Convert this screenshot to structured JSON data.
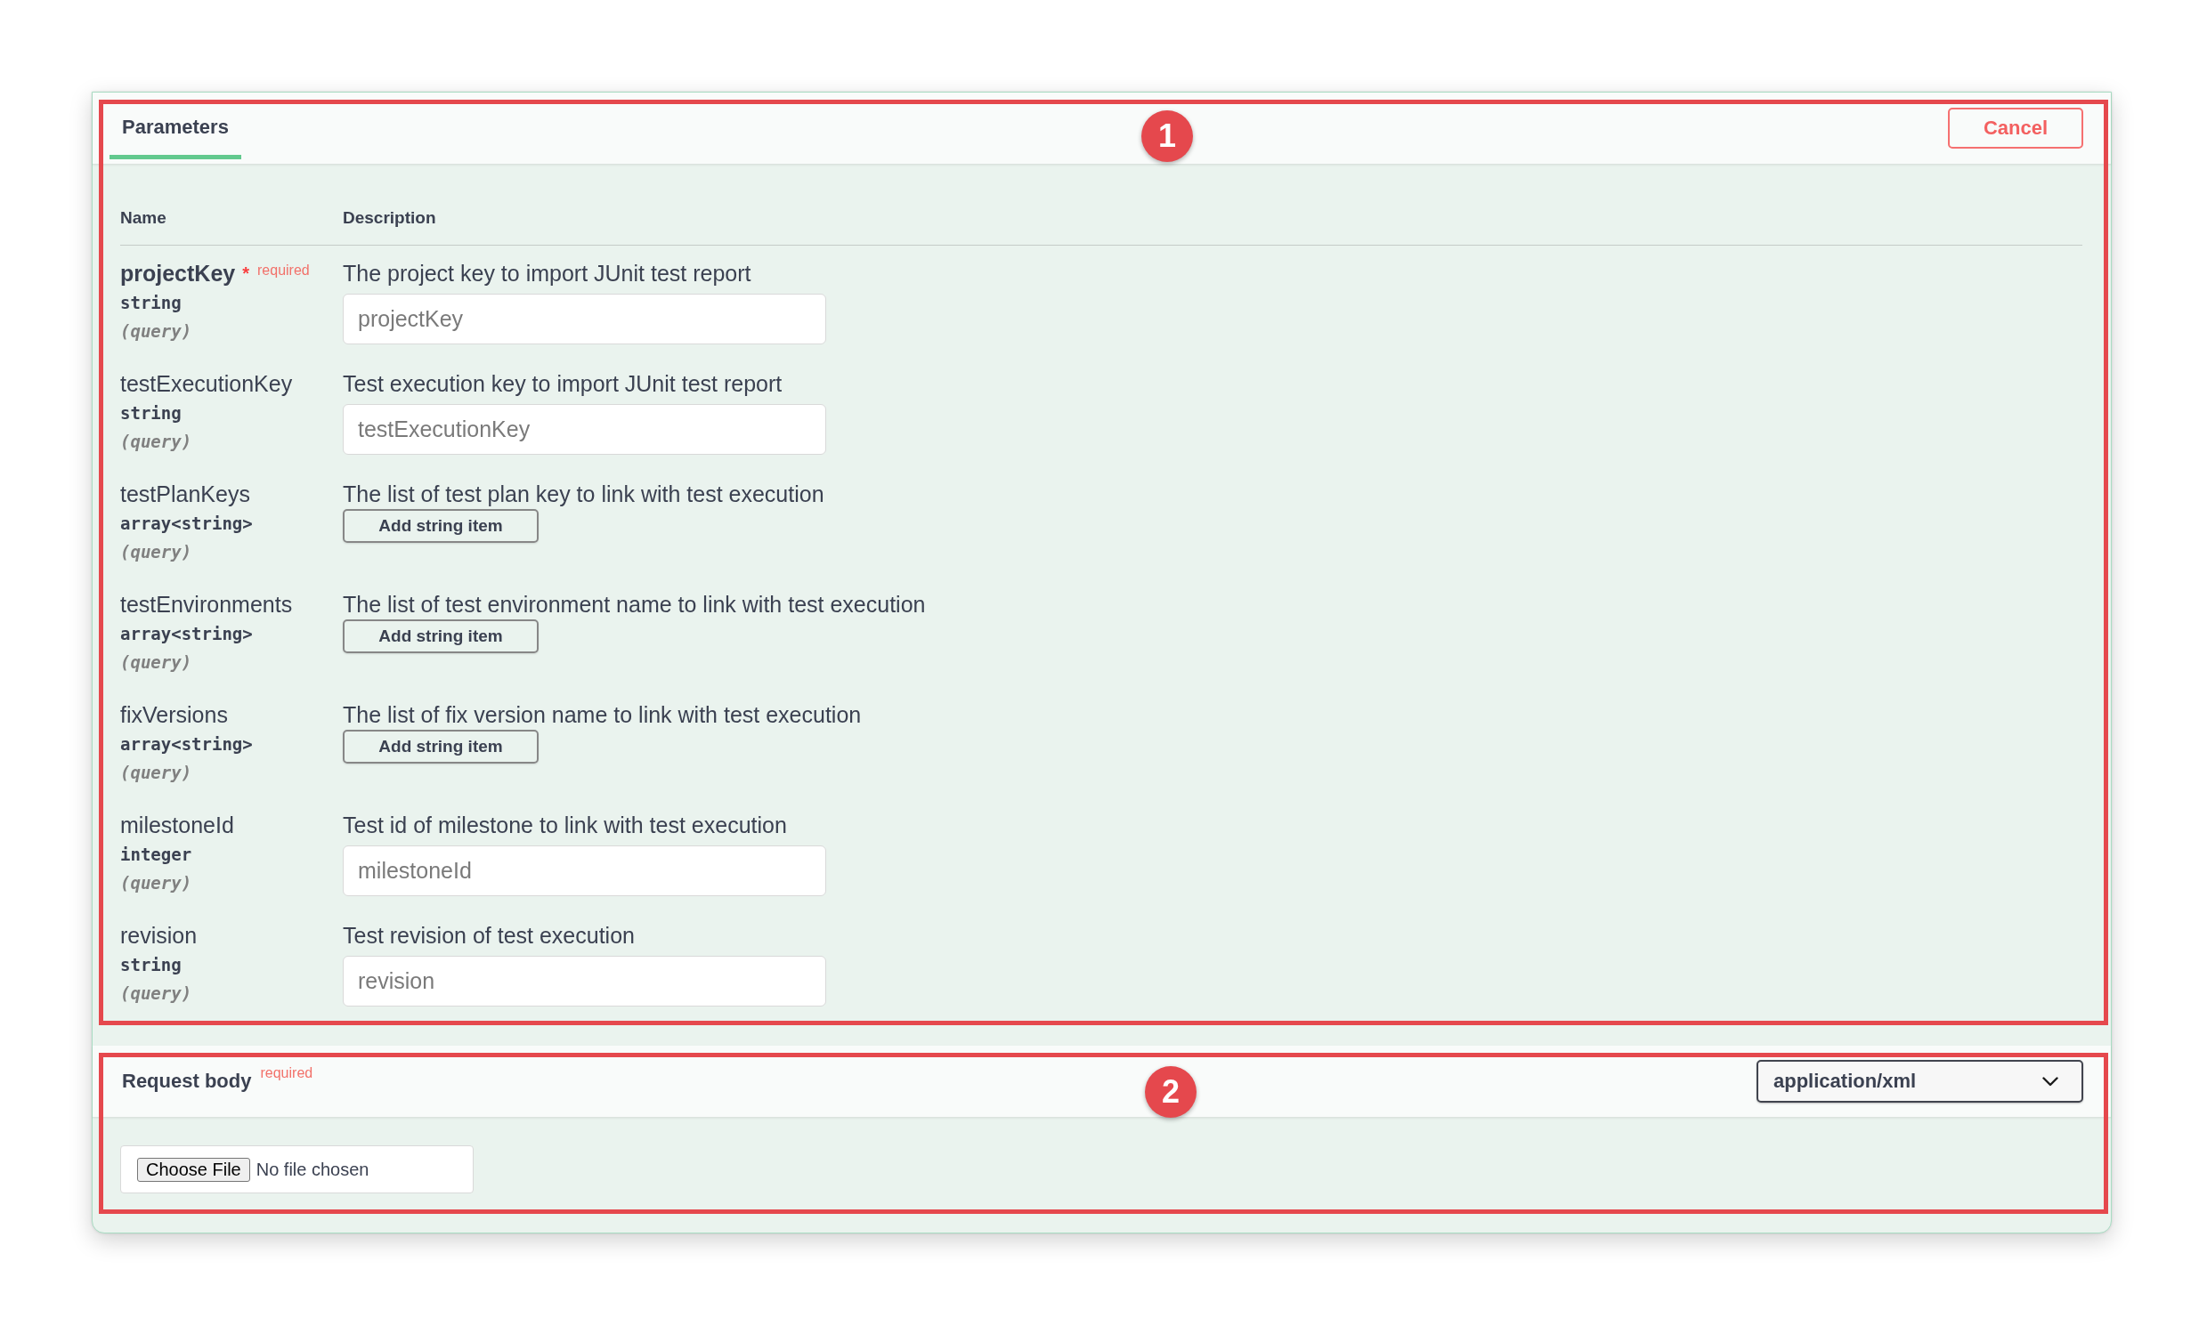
{
  "tabs": [
    {
      "label": "Parameters",
      "selected": true
    }
  ],
  "cancel_button": {
    "label": "Cancel"
  },
  "parameters": {
    "annotation": {
      "label": "1"
    },
    "columns": [
      "Name",
      "Description"
    ],
    "rows": [
      {
        "name": "projectKey",
        "required": true,
        "required_mark": "*",
        "required_label": "required",
        "type": "string",
        "location": "(query)",
        "description": "The project key to import JUnit test report",
        "kind": "text",
        "placeholder": "projectKey"
      },
      {
        "name": "testExecutionKey",
        "required": false,
        "type": "string",
        "location": "(query)",
        "description": "Test execution key to import JUnit test report",
        "kind": "text",
        "placeholder": "testExecutionKey"
      },
      {
        "name": "testPlanKeys",
        "required": false,
        "type": "array<string>",
        "location": "(query)",
        "description": "The list of test plan key to link with test execution",
        "kind": "array",
        "button": "Add string item"
      },
      {
        "name": "testEnvironments",
        "required": false,
        "type": "array<string>",
        "location": "(query)",
        "description": "The list of test environment name to link with test execution",
        "kind": "array",
        "button": "Add string item"
      },
      {
        "name": "fixVersions",
        "required": false,
        "type": "array<string>",
        "location": "(query)",
        "description": "The list of fix version name to link with test execution",
        "kind": "array",
        "button": "Add string item"
      },
      {
        "name": "milestoneId",
        "required": false,
        "type": "integer",
        "location": "(query)",
        "description": "Test id of milestone to link with test execution",
        "kind": "text",
        "placeholder": "milestoneId"
      },
      {
        "name": "revision",
        "required": false,
        "type": "string",
        "location": "(query)",
        "description": "Test revision of test execution",
        "kind": "text",
        "placeholder": "revision"
      }
    ]
  },
  "request_body": {
    "annotation": {
      "label": "2"
    },
    "title": "Request body",
    "required_label": "required",
    "content_type": "application/xml",
    "file_input": {
      "button": "Choose File",
      "status": "No file chosen"
    }
  }
}
